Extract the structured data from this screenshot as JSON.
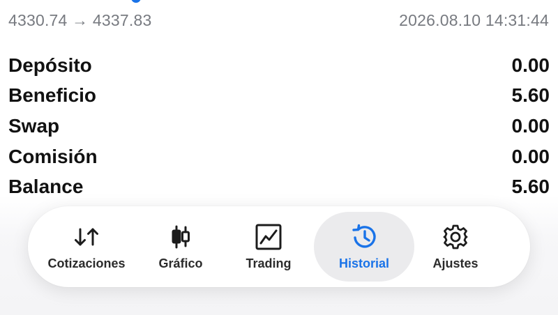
{
  "header": {
    "price_range": "4330.74 → 4337.83",
    "datetime": "2026.08.10 14:31:44"
  },
  "summary": [
    {
      "label": "Depósito",
      "value": "0.00"
    },
    {
      "label": "Beneficio",
      "value": "5.60"
    },
    {
      "label": "Swap",
      "value": "0.00"
    },
    {
      "label": "Comisión",
      "value": "0.00"
    },
    {
      "label": "Balance",
      "value": "5.60"
    }
  ],
  "tabbar": {
    "active": "Historial",
    "accent_color": "#1a73e8",
    "tabs": [
      {
        "label": "Cotizaciones",
        "icon": "sort-arrows-icon"
      },
      {
        "label": "Gráfico",
        "icon": "candlestick-icon"
      },
      {
        "label": "Trading",
        "icon": "trend-chart-icon"
      },
      {
        "label": "Historial",
        "icon": "history-clock-icon"
      },
      {
        "label": "Ajustes",
        "icon": "gear-icon"
      }
    ]
  }
}
